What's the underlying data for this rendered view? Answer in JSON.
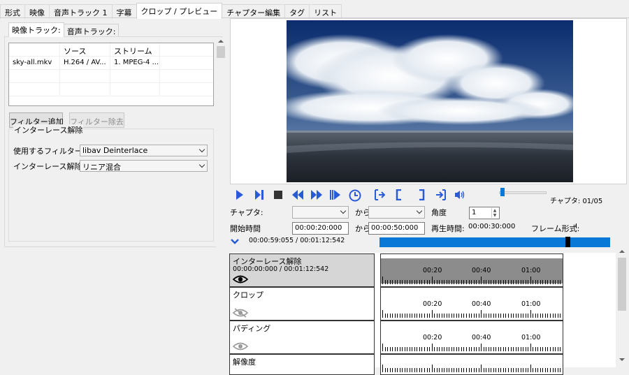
{
  "main_tabs": [
    "形式",
    "映像",
    "音声トラック 1",
    "字幕",
    "クロップ / プレビュー",
    "チャプター編集",
    "タグ",
    "リスト"
  ],
  "active_main_tab": "クロップ / プレビュー",
  "sub_tabs": [
    "映像トラック:",
    "音声トラック:"
  ],
  "track_table": {
    "columns": [
      "",
      "ソース",
      "ストリーム",
      ""
    ],
    "rows": [
      [
        "sky-all.mkv",
        "H.264 / AV...",
        "1. MPEG-4 ...",
        ""
      ]
    ]
  },
  "buttons": {
    "add_filter": "フィルター追加",
    "remove_filter": "フィルター除去"
  },
  "deinterlace": {
    "group_title": "インターレース解除",
    "filter_label": "使用するフィルター:",
    "filter_value": "libav Deinterlace",
    "mode_label": "インターレース解除",
    "mode_value": "リニア混合"
  },
  "controls": {
    "icons": [
      "play-icon",
      "step-forward-icon",
      "stop-icon",
      "rewind-icon",
      "fast-forward-icon",
      "next-frame-icon",
      "clock-icon",
      "mark-start-icon",
      "bracket-open-icon",
      "bracket-close-icon",
      "mark-end-icon",
      "volume-icon"
    ],
    "chapter_status": "チャプタ: 01/05",
    "chapter_label": "チャプタ:",
    "from_label": "から",
    "angle_label": "角度",
    "angle_value": "1",
    "start_time_label": "開始時間",
    "start_time_value": "00:00:20:000",
    "end_from_label": "から",
    "end_time_value": "00:00:50:000",
    "play_time_label": "再生時間:",
    "play_time_value": "00:00:30:000",
    "frame_format_label": "フレーム形式:",
    "frame_format_value": "I"
  },
  "timeline": {
    "position_text": "00:00:59:055 / 00:01:12:542",
    "position_fraction": 0.814,
    "color": "#0a78d7"
  },
  "filters": [
    {
      "name": "インターレース解除",
      "time": "00:00:00:000 / 00:01:12:542",
      "eye": "eye-icon",
      "active": true
    },
    {
      "name": "クロップ",
      "time": "",
      "eye": "eye-off-icon",
      "active": false
    },
    {
      "name": "パディング",
      "time": "",
      "eye": "eye-icon",
      "active": false
    },
    {
      "name": "解像度",
      "time": "",
      "eye": "",
      "active": false
    }
  ],
  "track_ticks": [
    "00:20",
    "00:40",
    "01:00"
  ]
}
